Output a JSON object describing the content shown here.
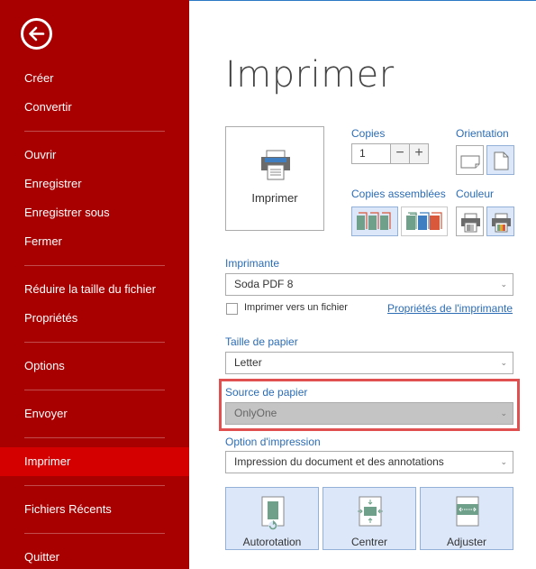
{
  "sidebar": {
    "back_label": "Retour",
    "items": [
      {
        "label": "Créer"
      },
      {
        "label": "Convertir"
      },
      {
        "label": "Ouvrir"
      },
      {
        "label": "Enregistrer"
      },
      {
        "label": "Enregistrer sous"
      },
      {
        "label": "Fermer"
      },
      {
        "label": "Réduire la taille du fichier"
      },
      {
        "label": "Propriétés"
      },
      {
        "label": "Options"
      },
      {
        "label": "Envoyer"
      },
      {
        "label": "Imprimer",
        "active": true
      },
      {
        "label": "Fichiers Récents"
      },
      {
        "label": "Quitter"
      }
    ]
  },
  "main": {
    "title": "Imprimer",
    "print_button": "Imprimer",
    "copies": {
      "label": "Copies",
      "value": "1",
      "minus": "−",
      "plus": "+"
    },
    "orientation": {
      "label": "Orientation",
      "options": [
        "Paysage",
        "Portrait"
      ],
      "selected": "Portrait"
    },
    "collate": {
      "label": "Copies assemblées",
      "options": [
        "Assemblées",
        "Non assemblées"
      ],
      "selected": "Assemblées"
    },
    "color": {
      "label": "Couleur",
      "options": [
        "Niveaux de gris",
        "Couleur"
      ],
      "selected": "Couleur"
    },
    "printer": {
      "label": "Imprimante",
      "value": "Soda PDF 8"
    },
    "print_to_file": {
      "label": "Imprimer vers un fichier",
      "checked": false
    },
    "printer_properties_link": "Propriétés de l'imprimante",
    "paper_size": {
      "label": "Taille de papier",
      "value": "Letter"
    },
    "paper_source": {
      "label": "Source de papier",
      "value": "OnlyOne"
    },
    "print_option": {
      "label": "Option d'impression",
      "value": "Impression du document et des annotations"
    },
    "layout_buttons": [
      {
        "label": "Autorotation"
      },
      {
        "label": "Centrer"
      },
      {
        "label": "Adjuster"
      }
    ]
  },
  "colors": {
    "sidebar_bg": "#a80000",
    "sidebar_active": "#d40000",
    "accent_blue": "#2b6cb5",
    "highlight_red": "#e05050",
    "selected_bg": "#dce8fa"
  }
}
